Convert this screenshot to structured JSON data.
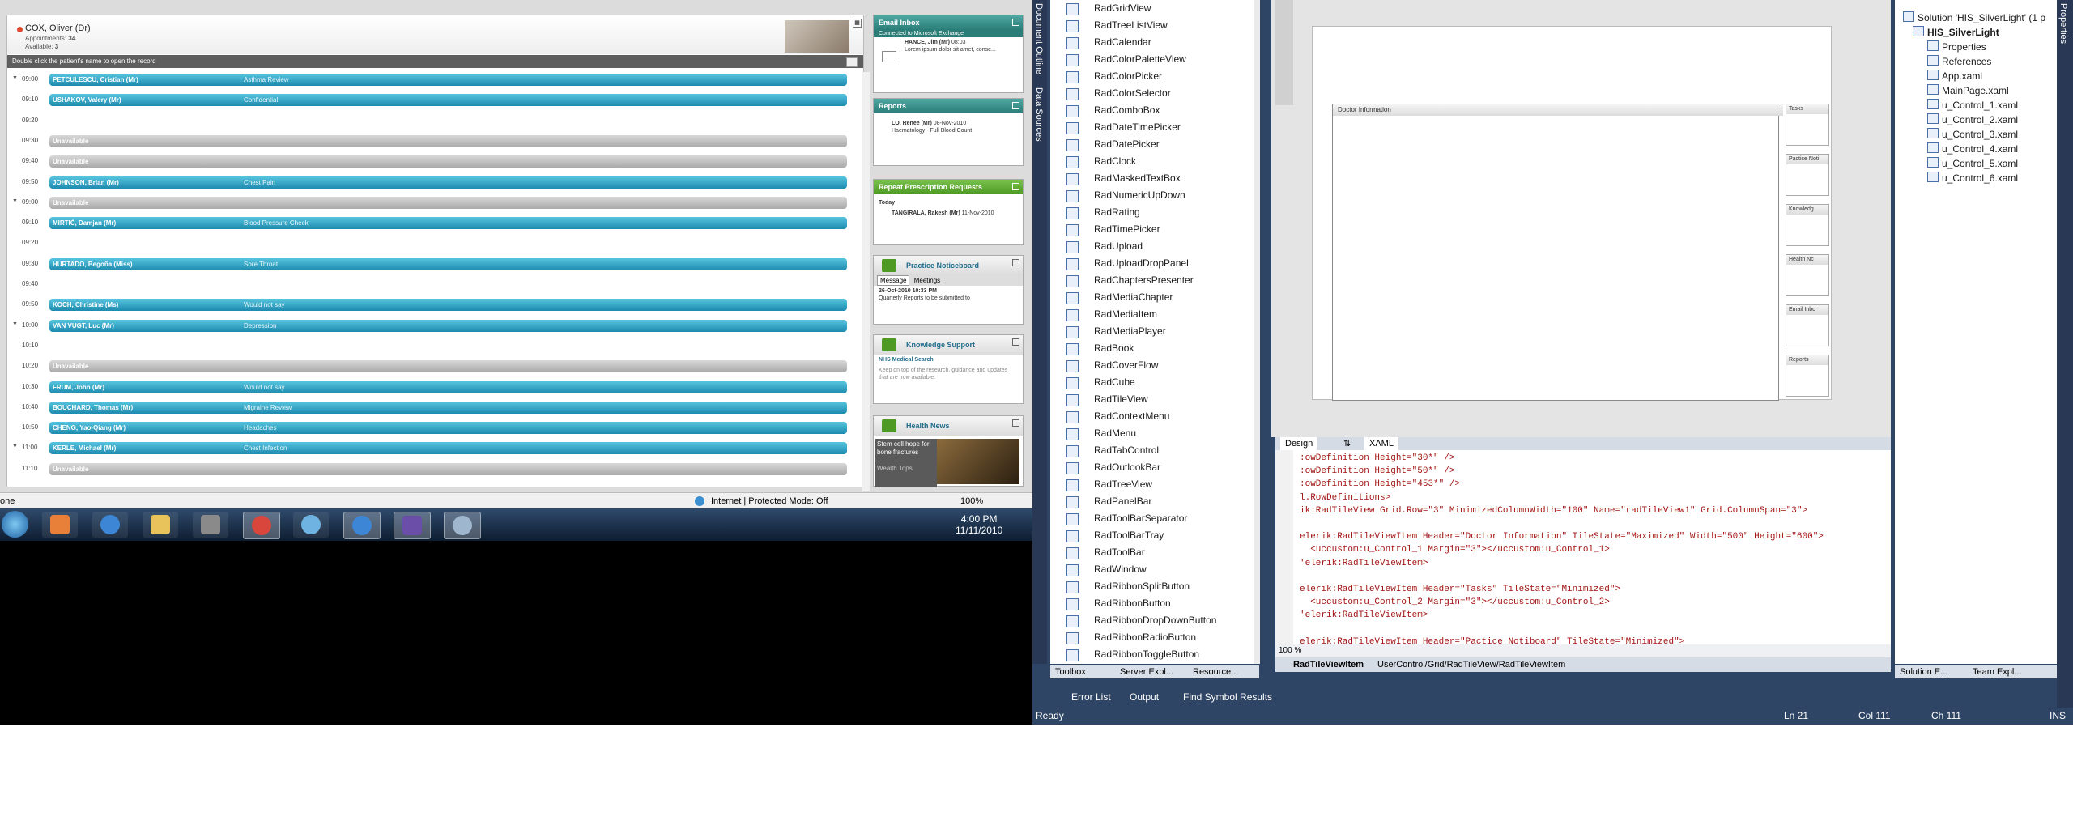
{
  "patient": {
    "name": "COX, Oliver (Dr)",
    "appointments_label": "Appointments:",
    "appointments": "34",
    "available_label": "Available:",
    "available": "3",
    "hint": "Double click the patient's name to open the record"
  },
  "schedule": [
    {
      "time": "09:00",
      "name": "PETCULESCU, Cristian (Mr)",
      "reason": "Asthma Review",
      "kind": "blue",
      "chev": "▼"
    },
    {
      "time": "09:10",
      "name": "USHAKOV, Valery (Mr)",
      "reason": "Confidential",
      "kind": "blue",
      "chev": ""
    },
    {
      "time": "09:20",
      "name": "",
      "reason": "",
      "kind": "none",
      "chev": ""
    },
    {
      "time": "09:30",
      "name": "Unavailable",
      "reason": "",
      "kind": "grey",
      "chev": ""
    },
    {
      "time": "09:40",
      "name": "Unavailable",
      "reason": "",
      "kind": "grey",
      "chev": ""
    },
    {
      "time": "09:50",
      "name": "JOHNSON, Brian (Mr)",
      "reason": "Chest Pain",
      "kind": "blue",
      "chev": ""
    },
    {
      "time": "09:00",
      "name": "Unavailable",
      "reason": "",
      "kind": "grey",
      "chev": "▼"
    },
    {
      "time": "09:10",
      "name": "MIRTIĆ, Damjan (Mr)",
      "reason": "Blood Pressure Check",
      "kind": "blue",
      "chev": ""
    },
    {
      "time": "09:20",
      "name": "",
      "reason": "",
      "kind": "none",
      "chev": ""
    },
    {
      "time": "09:30",
      "name": "HURTADO, Begoña (Miss)",
      "reason": "Sore Throat",
      "kind": "blue",
      "chev": ""
    },
    {
      "time": "09:40",
      "name": "",
      "reason": "",
      "kind": "none",
      "chev": ""
    },
    {
      "time": "09:50",
      "name": "KOCH, Christine (Ms)",
      "reason": "Would not say",
      "kind": "blue",
      "chev": ""
    },
    {
      "time": "10:00",
      "name": "VAN VUGT, Luc (Mr)",
      "reason": "Depression",
      "kind": "blue",
      "chev": "▼"
    },
    {
      "time": "10:10",
      "name": "",
      "reason": "",
      "kind": "none",
      "chev": ""
    },
    {
      "time": "10:20",
      "name": "Unavailable",
      "reason": "",
      "kind": "grey",
      "chev": ""
    },
    {
      "time": "10:30",
      "name": "FRUM, John (Mr)",
      "reason": "Would not say",
      "kind": "blue",
      "chev": ""
    },
    {
      "time": "10:40",
      "name": "BOUCHARD, Thomas (Mr)",
      "reason": "Migraine Review",
      "kind": "blue",
      "chev": ""
    },
    {
      "time": "10:50",
      "name": "CHENG, Yao-Qiang (Mr)",
      "reason": "Headaches",
      "kind": "blue",
      "chev": ""
    },
    {
      "time": "11:00",
      "name": "KERLE, Michael (Mr)",
      "reason": "Chest Infection",
      "kind": "blue",
      "chev": "▼"
    },
    {
      "time": "11:10",
      "name": "Unavailable",
      "reason": "",
      "kind": "grey",
      "chev": ""
    }
  ],
  "widgets": {
    "email": {
      "title": "Email Inbox",
      "sub": "Connected to Microsoft Exchange",
      "from": "HANCE, Jim (Mr)",
      "time": "08:03",
      "body": "Lorem ipsum dolor sit amet, conse..."
    },
    "reports": {
      "title": "Reports",
      "patient": "LO, Renee (Mr)",
      "date": "08-Nov-2010",
      "desc": "Haematology - Full Blood Count"
    },
    "repeat": {
      "title": "Repeat Prescription Requests",
      "today": "Today",
      "patient": "TANGIRALA, Rakesh (Mr)",
      "date": "11-Nov-2010"
    },
    "notice": {
      "title": "Practice Noticeboard",
      "tab1": "Message",
      "tab2": "Meetings",
      "date": "26-Oct-2010 10:33 PM",
      "body": "Quarterly Reports to be submitted to"
    },
    "knowledge": {
      "title": "Knowledge Support",
      "link": "NHS Medical Search",
      "body": "Keep on top of the research, guidance and updates that are now available."
    },
    "health": {
      "title": "Health News",
      "headline": "Stem cell hope for bone fractures",
      "foot": "Wealth Tops"
    }
  },
  "browser_status": {
    "zone": "Internet | Protected Mode: Off",
    "zoom": "100%",
    "left": "one"
  },
  "taskbar": {
    "time": "4:00 PM",
    "date": "11/11/2010"
  },
  "vs": {
    "side_tabs": [
      "Document Outline",
      "Data Sources"
    ],
    "toolbox": [
      "RadGridView",
      "RadTreeListView",
      "RadCalendar",
      "RadColorPaletteView",
      "RadColorPicker",
      "RadColorSelector",
      "RadComboBox",
      "RadDateTimePicker",
      "RadDatePicker",
      "RadClock",
      "RadMaskedTextBox",
      "RadNumericUpDown",
      "RadRating",
      "RadTimePicker",
      "RadUpload",
      "RadUploadDropPanel",
      "RadChaptersPresenter",
      "RadMediaChapter",
      "RadMediaItem",
      "RadMediaPlayer",
      "RadBook",
      "RadCoverFlow",
      "RadCube",
      "RadTileView",
      "RadContextMenu",
      "RadMenu",
      "RadTabControl",
      "RadOutlookBar",
      "RadTreeView",
      "RadPanelBar",
      "RadToolBarSeparator",
      "RadToolBarTray",
      "RadToolBar",
      "RadWindow",
      "RadRibbonSplitButton",
      "RadRibbonButton",
      "RadRibbonDropDownButton",
      "RadRibbonRadioButton",
      "RadRibbonToggleButton"
    ],
    "toolbox_tabs": [
      "Toolbox",
      "Server Expl...",
      "Resource..."
    ],
    "designer": {
      "doc_panel": "Doctor Information",
      "tiles": [
        "Tasks",
        "Pactice Noti",
        "Knowledg",
        "Health Nc",
        "Email Inbo",
        "Reports"
      ]
    },
    "design_tabs": {
      "design": "Design",
      "swap": "⇅",
      "xaml": "XAML"
    },
    "code": [
      ":owDefinition Height=\"30*\" />",
      ":owDefinition Height=\"50*\" />",
      ":owDefinition Height=\"453*\" />",
      "l.RowDefinitions>",
      "ik:RadTileView Grid.Row=\"3\" MinimizedColumnWidth=\"100\" Name=\"radTileView1\" Grid.ColumnSpan=\"3\">",
      "",
      "elerik:RadTileViewItem Header=\"Doctor Information\" TileState=\"Maximized\" Width=\"500\" Height=\"600\">",
      "  <uccustom:u_Control_1 Margin=\"3\"></uccustom:u_Control_1>",
      "'elerik:RadTileViewItem>",
      "",
      "elerik:RadTileViewItem Header=\"Tasks\" TileState=\"Minimized\">",
      "  <uccustom:u_Control_2 Margin=\"3\"></uccustom:u_Control_2>",
      "'elerik:RadTileViewItem>",
      "",
      "elerik:RadTileViewItem Header=\"Pactice Notiboard\" TileState=\"Minimized\">"
    ],
    "zoom": "100 %",
    "path": {
      "element": "RadTileViewItem",
      "trail": "UserControl/Grid/RadTileView/RadTileViewItem"
    },
    "solution": {
      "title": "Solution 'HIS_SilverLight' (1 p",
      "project": "HIS_SilverLight",
      "items": [
        "Properties",
        "References",
        "App.xaml",
        "MainPage.xaml",
        "u_Control_1.xaml",
        "u_Control_2.xaml",
        "u_Control_3.xaml",
        "u_Control_4.xaml",
        "u_Control_5.xaml",
        "u_Control_6.xaml"
      ]
    },
    "solution_tabs": [
      "Solution E...",
      "Team Expl..."
    ],
    "right_strip": "Properties",
    "bottom_tabs": [
      "Error List",
      "Output",
      "Find Symbol Results"
    ],
    "status": {
      "ready": "Ready",
      "ln": "Ln 21",
      "col": "Col 111",
      "ch": "Ch 111",
      "ins": "INS"
    }
  }
}
